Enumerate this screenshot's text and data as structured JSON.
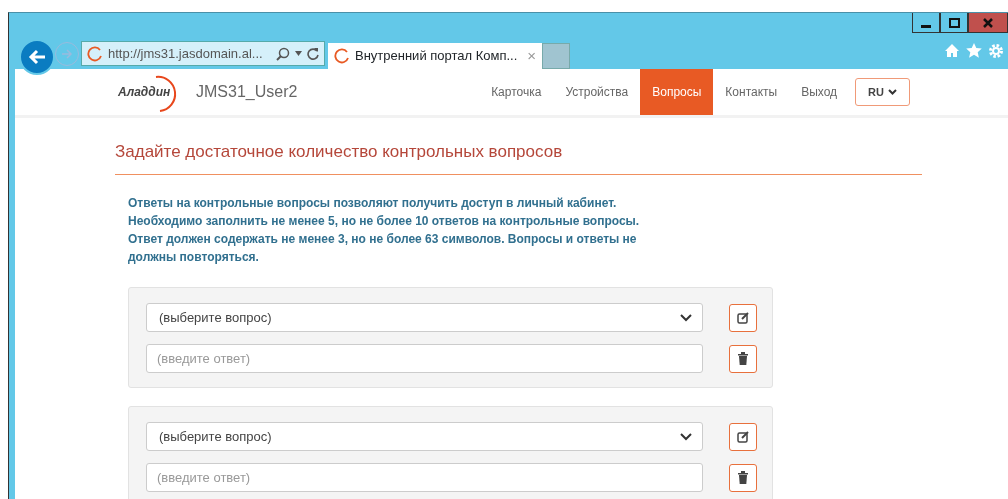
{
  "browser": {
    "address": "http://jms31.jasdomain.al...",
    "tab_title": "Внутренний портал Комп...",
    "tab_close": "×"
  },
  "header": {
    "logo": "Аладдин",
    "user": "JMS31_User2",
    "language": "RU",
    "nav": [
      {
        "label": "Карточка",
        "selected": false
      },
      {
        "label": "Устройства",
        "selected": false
      },
      {
        "label": "Вопросы",
        "selected": true
      },
      {
        "label": "Контакты",
        "selected": false
      },
      {
        "label": "Выход",
        "selected": false
      }
    ]
  },
  "title": "Задайте достаточное количество контрольных вопросов",
  "info": [
    "Ответы на контрольные вопросы позволяют получить доступ в личный кабинет.",
    "Необходимо заполнить не менее 5, но не более 10 ответов на контрольные вопросы.",
    "Ответ должен содержать не менее 3, но не более 63 символов. Вопросы и ответы не",
    "должны повторяться."
  ],
  "questions": [
    {
      "question": "(выберите вопрос)",
      "answer_placeholder": "(введите ответ)"
    },
    {
      "question": "(выберите вопрос)",
      "answer_placeholder": "(введите ответ)"
    }
  ]
}
